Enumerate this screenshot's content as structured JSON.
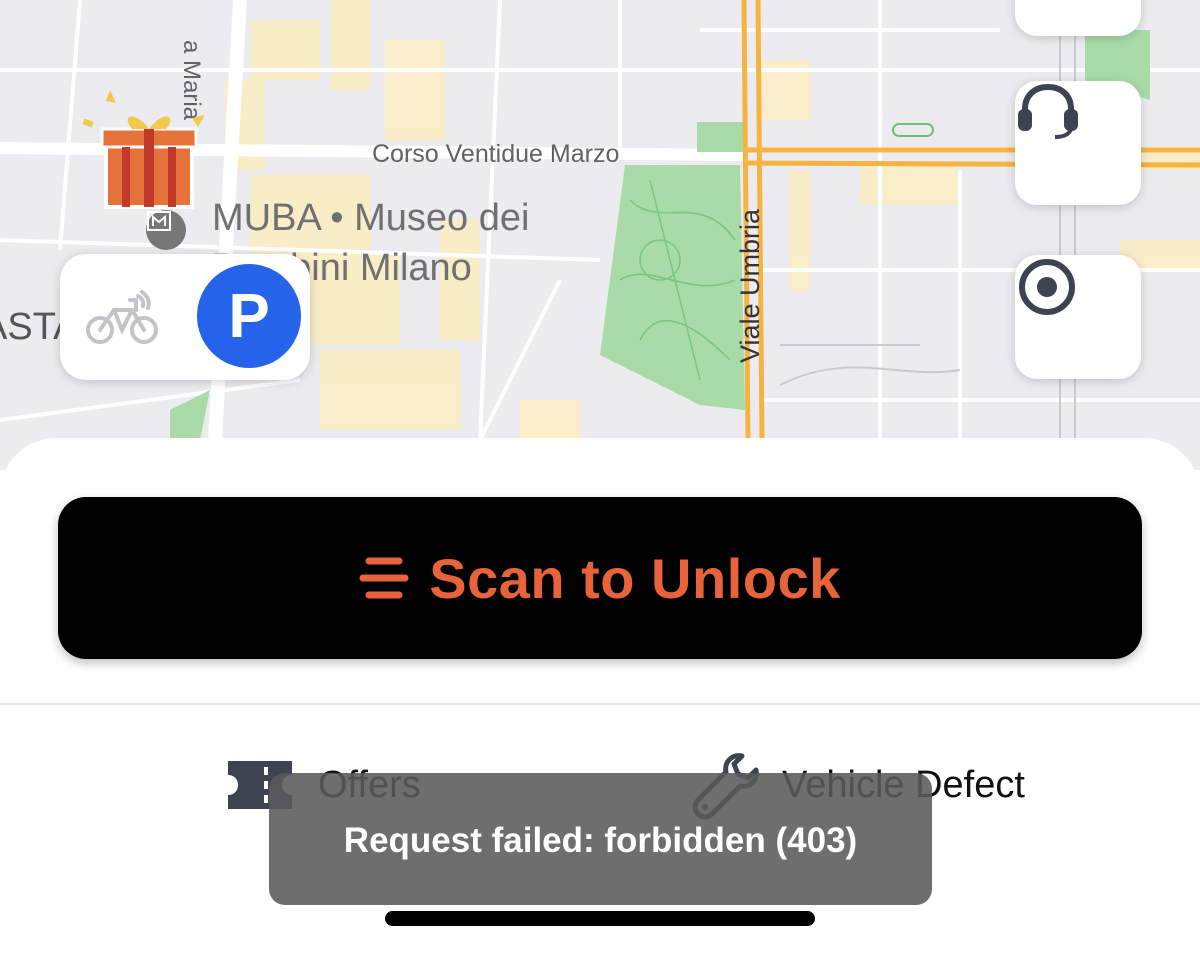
{
  "map": {
    "labels": {
      "street_top": "a Maria",
      "corso": "Corso Ventidue Marzo",
      "viale": "Viale Umbria",
      "museum_line1": "MUBA • Museo dei",
      "museum_line2": "Bambini Milano",
      "left_edge": "ASTA"
    },
    "icons": {
      "gift": "gift-icon",
      "museum": "museum-icon",
      "support": "headset-icon",
      "locate": "locate-icon",
      "vehicle": "bicycle-icon"
    },
    "parking_label": "P"
  },
  "sheet": {
    "scan_label": "Scan to Unlock",
    "actions": [
      {
        "label": "Offers",
        "icon": "ticket-icon"
      },
      {
        "label": "Vehicle Defect",
        "icon": "wrench-icon"
      }
    ]
  },
  "toast": {
    "message": "Request failed: forbidden (403)"
  },
  "colors": {
    "accent": "#e8623a",
    "parking": "#2563eb",
    "map_bg": "#ececf0",
    "park_green": "#a8dba8",
    "road_yellow": "#f5b342"
  }
}
